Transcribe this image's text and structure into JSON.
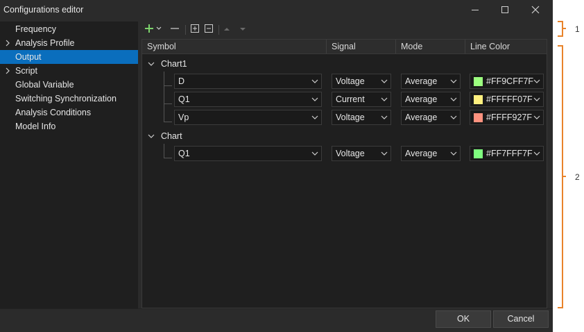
{
  "window": {
    "title": "Configurations editor"
  },
  "sidebar": {
    "items": [
      {
        "label": "Frequency",
        "expandable": false,
        "selected": false
      },
      {
        "label": "Analysis Profile",
        "expandable": true,
        "selected": false
      },
      {
        "label": "Output",
        "expandable": false,
        "selected": true
      },
      {
        "label": "Script",
        "expandable": true,
        "selected": false
      },
      {
        "label": "Global Variable",
        "expandable": false,
        "selected": false
      },
      {
        "label": "Switching Synchronization",
        "expandable": false,
        "selected": false
      },
      {
        "label": "Analysis Conditions",
        "expandable": false,
        "selected": false
      },
      {
        "label": "Model Info",
        "expandable": false,
        "selected": false
      }
    ]
  },
  "toolbar": {
    "icons": [
      "add-icon",
      "dropdown-chevron-icon",
      "remove-icon",
      "expand-all-icon",
      "collapse-all-icon",
      "move-up-icon",
      "move-down-icon"
    ]
  },
  "table": {
    "columns": [
      "Symbol",
      "Signal",
      "Mode",
      "Line Color"
    ],
    "groups": [
      {
        "name": "Chart1",
        "rows": [
          {
            "symbol": "D",
            "signal": "Voltage",
            "mode": "Average",
            "color": "#FF9CFF7F",
            "swatch": "#9CFF7F"
          },
          {
            "symbol": "Q1",
            "signal": "Current",
            "mode": "Average",
            "color": "#FFFFF07F",
            "swatch": "#FFF07F"
          },
          {
            "symbol": "Vp",
            "signal": "Voltage",
            "mode": "Average",
            "color": "#FFFF927F",
            "swatch": "#FF927F"
          }
        ]
      },
      {
        "name": "Chart",
        "rows": [
          {
            "symbol": "Q1",
            "signal": "Voltage",
            "mode": "Average",
            "color": "#FF7FFF7F",
            "swatch": "#7FFF7F"
          }
        ]
      }
    ]
  },
  "buttons": {
    "ok": "OK",
    "cancel": "Cancel"
  },
  "annotations": {
    "one": "1",
    "two": "2"
  },
  "colors": {
    "accent": "#0A6EBD",
    "annotation": "#E8832A",
    "add_icon": "#7CD36B"
  }
}
